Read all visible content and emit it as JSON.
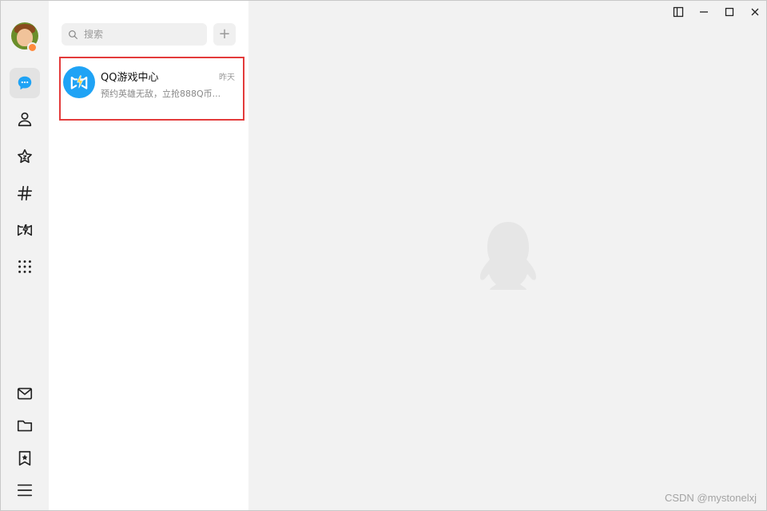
{
  "sidebar": {
    "avatar_status_color": "#ff8a3d",
    "items": [
      {
        "icon": "message-bubble-icon",
        "active": true
      },
      {
        "icon": "contacts-icon"
      },
      {
        "icon": "star-icon"
      },
      {
        "icon": "hashtag-icon"
      },
      {
        "icon": "game-icon"
      },
      {
        "icon": "apps-grid-icon"
      }
    ],
    "bottom_items": [
      {
        "icon": "mail-icon"
      },
      {
        "icon": "folder-icon"
      },
      {
        "icon": "bookmark-icon"
      },
      {
        "icon": "menu-icon"
      }
    ]
  },
  "search": {
    "placeholder": "搜索",
    "add_label": "+"
  },
  "chats": [
    {
      "name": "QQ游戏中心",
      "time": "昨天",
      "preview": "预约英雄无敌，立抢888Q币...",
      "avatar_color": "#1fa3f5",
      "highlight_color": "#e33b3b"
    }
  ],
  "window_controls": [
    "sidebar-toggle-icon",
    "minimize-icon",
    "maximize-icon",
    "close-icon"
  ],
  "watermark": "CSDN @mystonelxj",
  "colors": {
    "rail_bg": "#f2f2f2",
    "list_bg": "#ffffff",
    "main_bg": "#f2f2f2",
    "accent": "#1fa3f5"
  }
}
